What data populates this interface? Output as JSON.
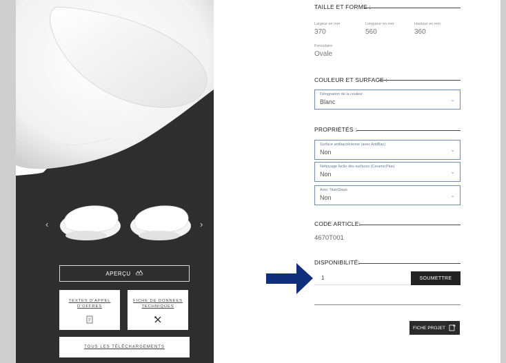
{
  "gallery": {
    "prev_arrow": "‹",
    "next_arrow": "›",
    "preview_label": "APERÇU",
    "downloads": [
      {
        "label": "TEXTES D'APPEL D'OFFRES",
        "icon": "document-icon"
      },
      {
        "label": "FICHE DE DONNÉES TECHNIQUES",
        "icon": "tools-icon"
      }
    ],
    "all_downloads_label": "TOUS LES TÉLÉCHARGEMENTS"
  },
  "size_shape": {
    "title": "TAILLE ET FORME :",
    "width_label": "Largeur en mm",
    "width_value": "370",
    "length_label": "Longueur en mm",
    "length_value": "560",
    "height_label": "Hauteur en mm",
    "height_value": "360",
    "shape_label": "Formulaire",
    "shape_value": "Ovale"
  },
  "color_surface": {
    "title": "COULEUR ET SURFACE :",
    "color": {
      "label": "Désignation de la couleur",
      "value": "Blanc"
    }
  },
  "properties": {
    "title": "PROPRIÉTÉS :",
    "items": [
      {
        "label": "Surface antibactérienne (avec AntiBac)",
        "value": "Non"
      },
      {
        "label": "Nettoyage facile des surfaces (CeramicPlus)",
        "value": "Non"
      },
      {
        "label": "Avec TitanGlaze",
        "value": "Non"
      }
    ]
  },
  "article": {
    "title": "CODE ARTICLE:",
    "code": "4670T001"
  },
  "availability": {
    "title": "DISPONIBILITÉ:",
    "quantity": "1",
    "submit_label": "SOUMETTRE"
  },
  "project": {
    "button_label": "FICHE PROJET"
  },
  "colors": {
    "dark_panel": "#2e2e2e",
    "select_border": "#6b8db5",
    "annotation_arrow": "#0f2f7a"
  }
}
